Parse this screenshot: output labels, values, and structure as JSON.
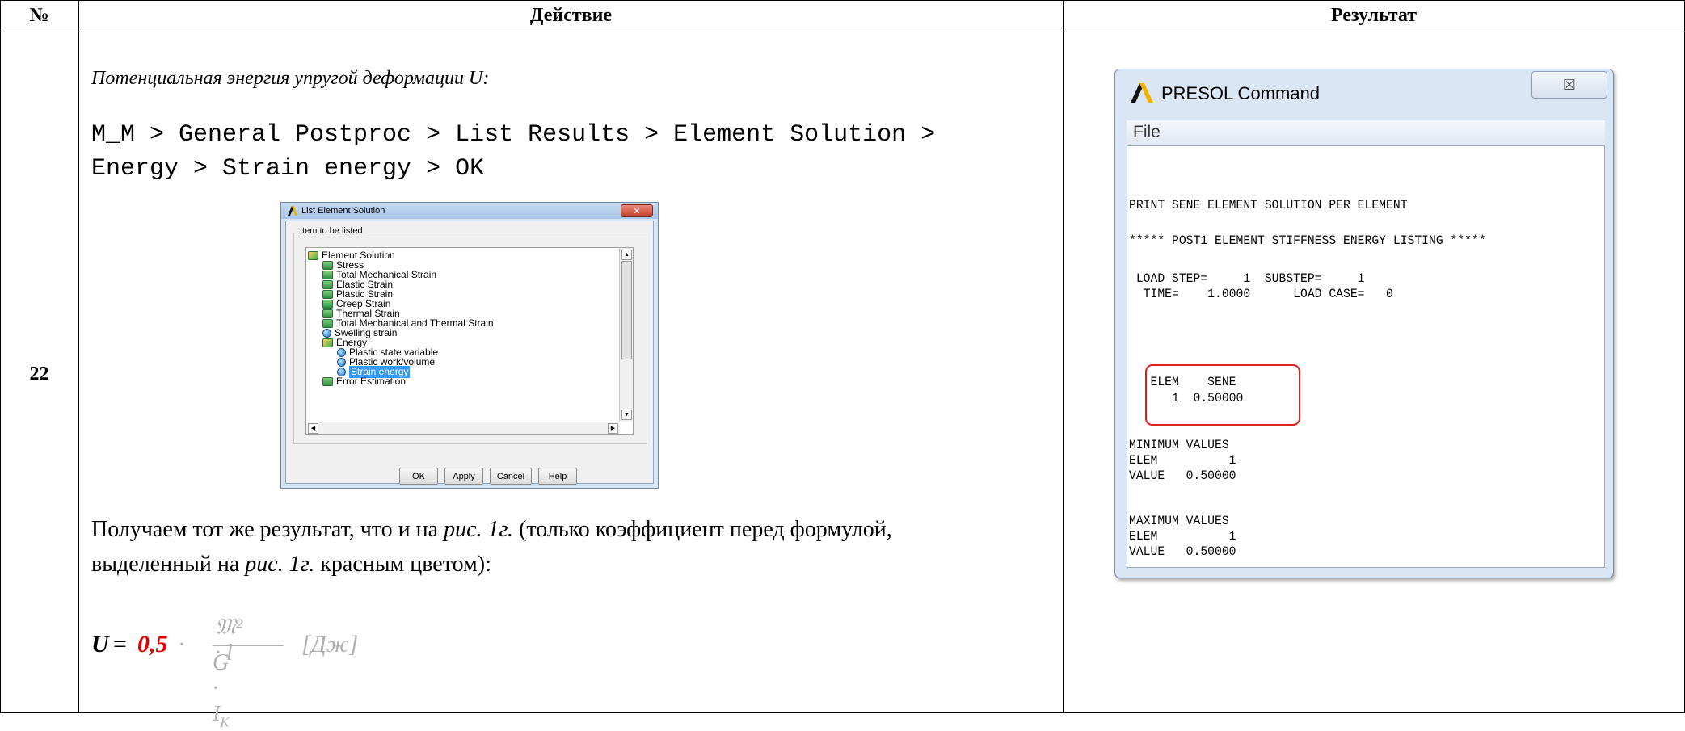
{
  "table": {
    "headers": [
      "№",
      "Действие",
      "Результат"
    ],
    "row_number": "22"
  },
  "action": {
    "heading": "Потенциальная энергия упругой деформации U:",
    "path_line1": "M_M > General Postproc > List Results > Element Solution >",
    "path_line2": "Energy > Strain energy > OK",
    "text_line1_a": "Получаем тот же результат, что и на ",
    "text_ref1": "рис. 1г.",
    "text_line1_b": " (только коэффициент перед формулой,",
    "text_line2_a": "выделенный на ",
    "text_ref2": "рис. 1г.",
    "text_line2_b": " красным цветом):"
  },
  "formula": {
    "lhs": "U",
    "eq": "=",
    "coefficient": "0,5",
    "dot": "·",
    "numerator": "𝔐² · l",
    "denominator": "G · I",
    "denominator_sub": "К",
    "unit": "[Дж]",
    "colors": {
      "coefficient": "#e00000",
      "rest": "#b0b0b0"
    }
  },
  "dialog": {
    "title": "List Element Solution",
    "close_glyph": "✕",
    "group_label": "Item to be listed",
    "tree": [
      {
        "label": "Element Solution",
        "level": 0,
        "icon": "folder-open-icon"
      },
      {
        "label": "Stress",
        "level": 1,
        "icon": "folder-icon"
      },
      {
        "label": "Total Mechanical Strain",
        "level": 1,
        "icon": "folder-icon"
      },
      {
        "label": "Elastic Strain",
        "level": 1,
        "icon": "folder-icon"
      },
      {
        "label": "Plastic Strain",
        "level": 1,
        "icon": "folder-icon"
      },
      {
        "label": "Creep Strain",
        "level": 1,
        "icon": "folder-icon"
      },
      {
        "label": "Thermal Strain",
        "level": 1,
        "icon": "folder-icon"
      },
      {
        "label": "Total Mechanical and Thermal Strain",
        "level": 1,
        "icon": "folder-icon"
      },
      {
        "label": "Swelling strain",
        "level": 1,
        "icon": "leaf-icon"
      },
      {
        "label": "Energy",
        "level": 1,
        "icon": "folder-open-icon"
      },
      {
        "label": "Plastic state variable",
        "level": 2,
        "icon": "leaf-icon"
      },
      {
        "label": "Plastic work/volume",
        "level": 2,
        "icon": "leaf-icon"
      },
      {
        "label": "Strain energy",
        "level": 2,
        "icon": "leaf-icon",
        "selected": true
      },
      {
        "label": "Error Estimation",
        "level": 1,
        "icon": "folder-icon"
      }
    ],
    "buttons": {
      "ok": "OK",
      "apply": "Apply",
      "cancel": "Cancel",
      "help": "Help"
    },
    "selection_color": "#3399ff"
  },
  "presol": {
    "title": "PRESOL  Command",
    "close_glyph": "☒",
    "menu_file": "File",
    "lines": [
      "PRINT SENE ELEMENT SOLUTION PER ELEMENT",
      "***** POST1 ELEMENT STIFFNESS ENERGY LISTING *****",
      " LOAD STEP=     1  SUBSTEP=     1",
      "  TIME=    1.0000      LOAD CASE=   0",
      "   ELEM    SENE",
      "      1  0.50000",
      "MINIMUM VALUES",
      "ELEM          1",
      "VALUE   0.50000",
      "MAXIMUM VALUES",
      "ELEM          1",
      "VALUE   0.50000"
    ],
    "highlight_color": "#e02020"
  }
}
